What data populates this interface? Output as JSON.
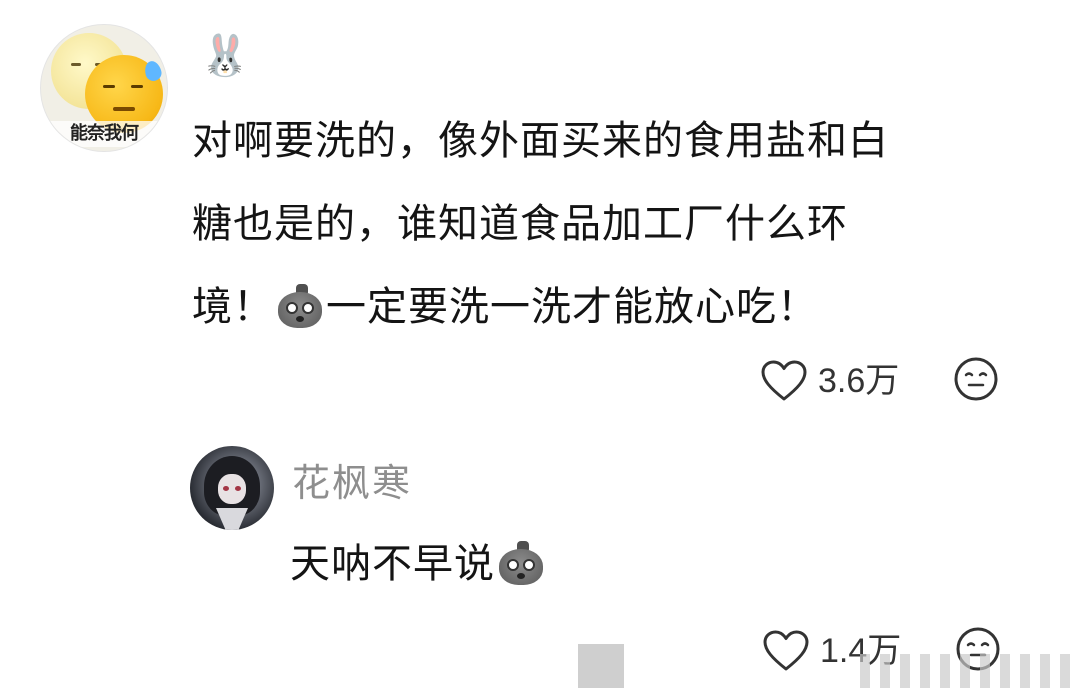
{
  "comment": {
    "avatar_caption": "能奈我何",
    "user_emoji": "🐰",
    "text_lines": [
      "对啊要洗的，像外面买来的食用盐和白",
      "糖也是的，谁知道食品加工厂什么环"
    ],
    "text_line3_before": "境！",
    "text_line3_after": "一定要洗一洗才能放心吃！",
    "sticker_icon": "crying-bag-sticker",
    "like_count": "3.6万",
    "emoji_icon": "neutral-face-icon"
  },
  "reply": {
    "username": "花枫寒",
    "text": "天呐不早说",
    "sticker_icon": "crying-bag-sticker",
    "like_count": "1.4万",
    "emoji_icon": "neutral-face-icon"
  },
  "colors": {
    "text_primary": "#141414",
    "username_gray": "#8e8e8e",
    "icon_gray": "#333333"
  }
}
